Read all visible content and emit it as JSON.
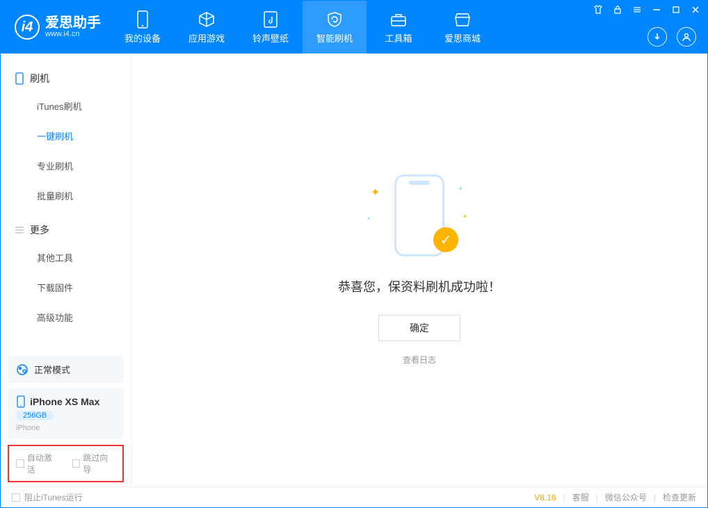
{
  "app": {
    "title": "爱思助手",
    "subtitle": "www.i4.cn"
  },
  "header_tabs": {
    "device": "我的设备",
    "apps": "应用游戏",
    "wallpaper": "铃声壁纸",
    "flash": "智能刷机",
    "toolbox": "工具箱",
    "store": "爱思商城"
  },
  "sidebar": {
    "section1": "刷机",
    "items1": [
      "iTunes刷机",
      "一键刷机",
      "专业刷机",
      "批量刷机"
    ],
    "section2": "更多",
    "items2": [
      "其他工具",
      "下载固件",
      "高级功能"
    ]
  },
  "mode": {
    "label": "正常模式"
  },
  "device": {
    "name": "iPhone XS Max",
    "storage": "256GB",
    "type": "iPhone"
  },
  "checkboxes": {
    "auto_activate": "自动激活",
    "skip_guide": "跳过向导"
  },
  "main": {
    "success": "恭喜您，保资料刷机成功啦！",
    "ok": "确定",
    "view_log": "查看日志"
  },
  "footer": {
    "block_itunes": "阻止iTunes运行",
    "version": "V8.16",
    "support": "客服",
    "wechat": "微信公众号",
    "update": "检查更新"
  }
}
